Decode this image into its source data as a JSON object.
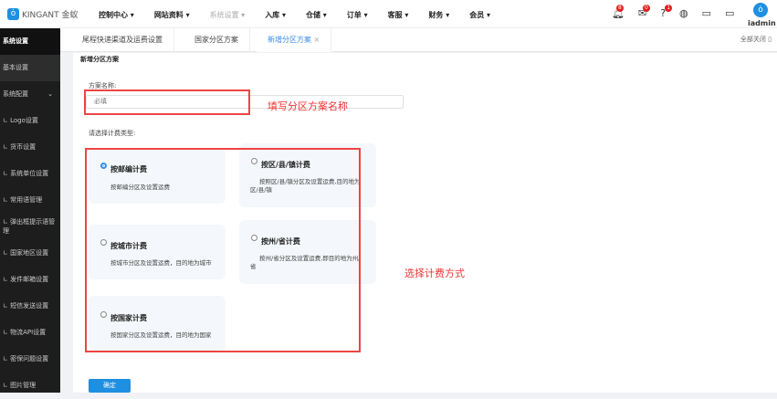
{
  "header": {
    "logo": "KINGANT 金蚁",
    "nav": [
      {
        "label": "控制中心 ▾"
      },
      {
        "label": "网站资料 ▾"
      },
      {
        "label": "系统设置 ▾",
        "dim": true
      },
      {
        "label": "入库 ▾"
      },
      {
        "label": "仓储 ▾"
      },
      {
        "label": "订单 ▾"
      },
      {
        "label": "客服 ▾"
      },
      {
        "label": "财务 ▾"
      },
      {
        "label": "会员 ▾"
      }
    ],
    "badges": {
      "bell": "8",
      "message": "0",
      "help": "1"
    },
    "username": "iadmin"
  },
  "sidebar": {
    "title": "系统设置",
    "items": [
      "基本设置",
      "系统配置",
      "∟ Logo设置",
      "∟ 货币设置",
      "∟ 系统单位设置",
      "∟ 常用语管理",
      "∟ 弹出框提示语管理",
      "∟ 国家地区设置",
      "∟ 发件邮箱设置",
      "∟ 短信发送设置",
      "∟ 物流API设置",
      "∟ 密保问题设置",
      "∟ 图片管理"
    ]
  },
  "tabs": [
    "尾程快递渠道及运费设置",
    "国家分区方案",
    "新增分区方案"
  ],
  "close_all": "全部关闭",
  "form": {
    "title": "新增分区方案",
    "name_label": "方案名称:",
    "name_placeholder": "必填",
    "type_label": "请选择计费类型:",
    "submit": "确定",
    "options": [
      {
        "title": "按邮编计费",
        "desc": "按邮编分区及设置运费",
        "selected": true
      },
      {
        "title": "按区/县/镇计费",
        "desc": "按照区/县/镇分区及设置运费,目的地为区/县/镇",
        "selected": false
      },
      {
        "title": "按城市计费",
        "desc": "按城市分区及设置运费，目的地为城市",
        "selected": false
      },
      {
        "title": "按州/省计费",
        "desc": "按州/省分区及设置运费,即目的地为州/省",
        "selected": false
      },
      {
        "title": "按国家计费",
        "desc": "按国家分区及设置运费，目的地为国家",
        "selected": false
      }
    ]
  },
  "annotations": {
    "name": "填写分区方案名称",
    "type": "选择计费方式"
  },
  "colors": {
    "accent": "#1e8fe1",
    "annotation": "#e44444"
  }
}
